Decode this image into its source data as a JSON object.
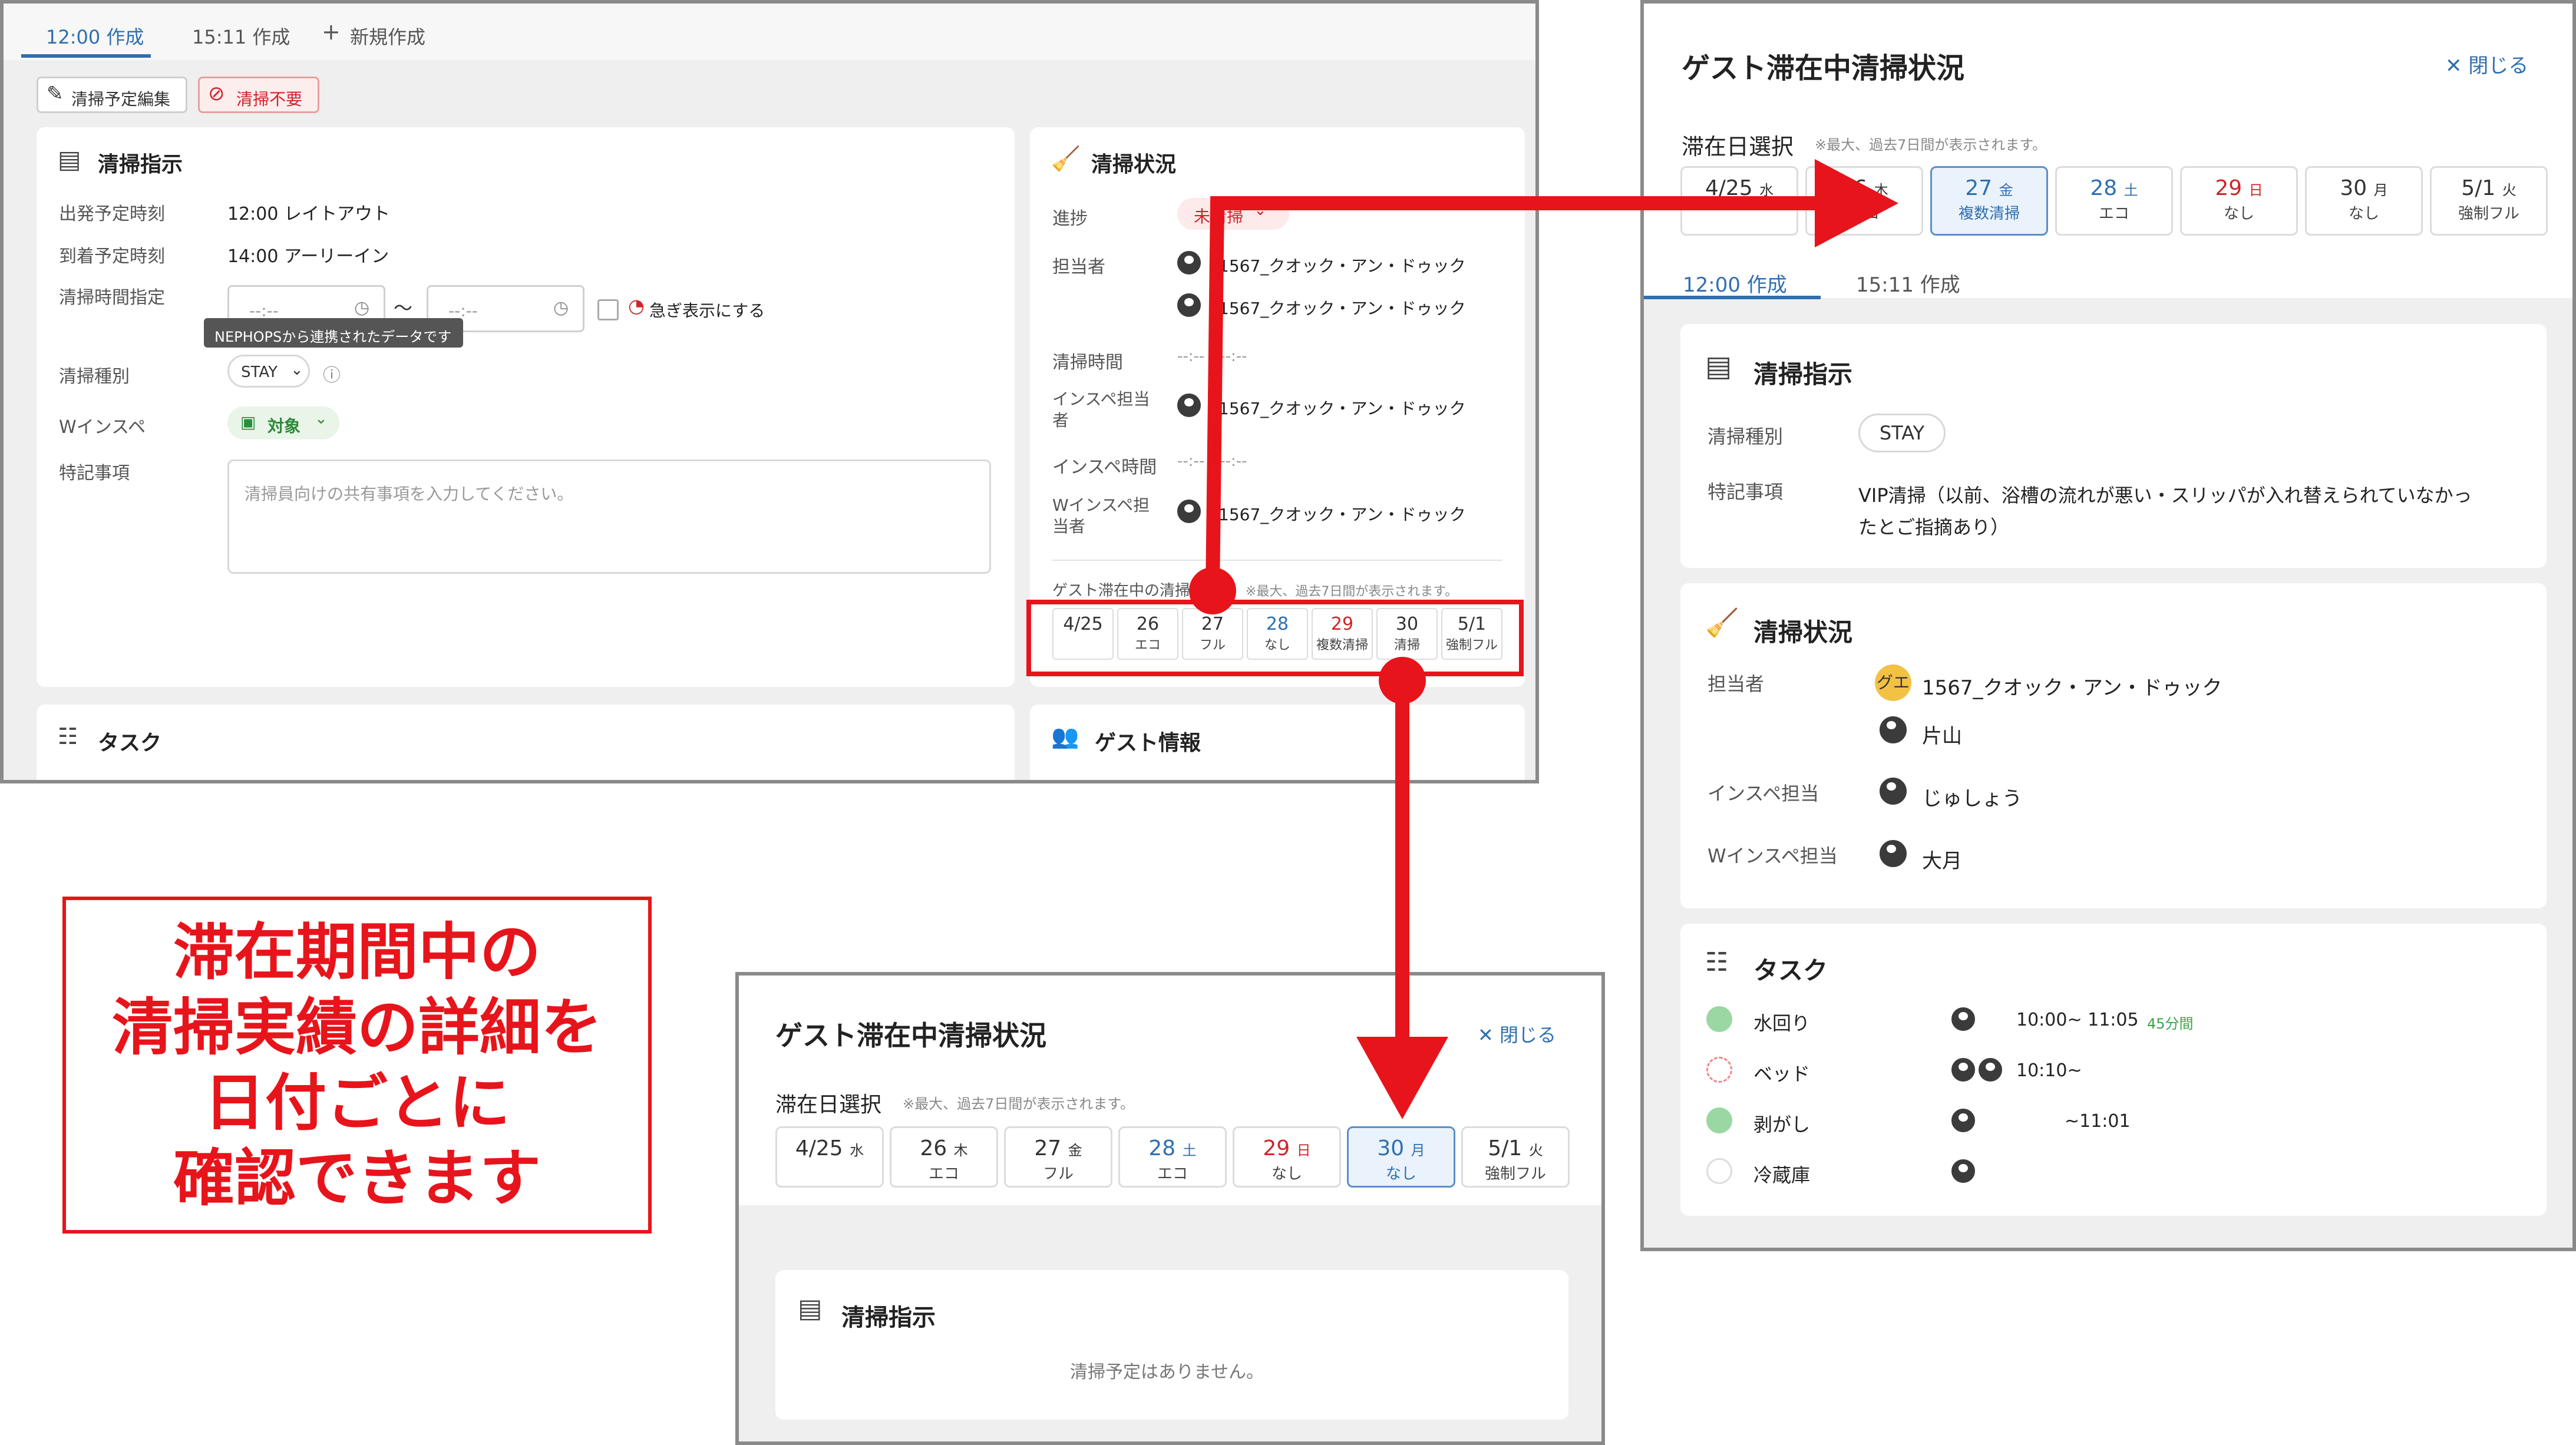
{
  "left_panel": {
    "tabs": [
      "12:00 作成",
      "15:11 作成",
      "新規作成"
    ],
    "toolbar": {
      "edit_label": "清掃予定編集",
      "unneeded_label": "清掃不要"
    },
    "instruction": {
      "title": "清掃指示",
      "rows": [
        {
          "label": "出発予定時刻",
          "value": "12:00 レイトアウト"
        },
        {
          "label": "到着予定時刻",
          "value": "14:00 アーリーイン"
        }
      ],
      "time_label": "清掃時間指定",
      "time_from_placeholder": "--:--",
      "time_to_placeholder": "--:--",
      "time_sep": "〜",
      "urgent_label": "急ぎ表示にする",
      "tooltip": "NEPHOPSから連携されたデータです",
      "type_label": "清掃種別",
      "type_value": "STAY",
      "winspect_label": "Wインスペ",
      "winspect_value": "対象",
      "notes_label": "特記事項",
      "notes_placeholder": "清掃員向けの共有事項を入力してください。"
    },
    "status": {
      "title": "清掃状況",
      "progress_label": "進捗",
      "progress_value": "未清掃",
      "staff_label": "担当者",
      "staff": [
        "1567_クオック・アン・ドゥック",
        "1567_クオック・アン・ドゥック"
      ],
      "clean_time_label": "清掃時間",
      "clean_time_value": "--:-- - --:--",
      "inspector_label": "インスペ担当者",
      "inspector_value": "1567_クオック・アン・ドゥック",
      "inspect_time_label": "インスペ時間",
      "inspect_time_value": "--:-- - --:--",
      "w_inspector_label": "Wインスペ担当者",
      "w_inspector_value": "1567_クオック・アン・ドゥック",
      "guest_label": "ゲスト滞在中の清掃状況",
      "guest_note": "※最大、過去7日間が表示されます。",
      "days": [
        {
          "date": "4/25",
          "status": ""
        },
        {
          "date": "26",
          "status": "エコ"
        },
        {
          "date": "27",
          "status": "フル"
        },
        {
          "date": "28",
          "status": "なし"
        },
        {
          "date": "29",
          "status": "複数清掃"
        },
        {
          "date": "30",
          "status": "清掃"
        },
        {
          "date": "5/1",
          "status": "強制フル"
        }
      ]
    },
    "task_title": "タスク",
    "guest_info_title": "ゲスト情報"
  },
  "right_panel": {
    "title": "ゲスト滞在中清掃状況",
    "close_label": "閉じる",
    "select_label": "滞在日選択",
    "select_note": "※最大、過去7日間が表示されます。",
    "days": [
      {
        "date": "4/25",
        "wd": "水",
        "status": ""
      },
      {
        "date": "26",
        "wd": "木",
        "status": "エコ"
      },
      {
        "date": "27",
        "wd": "金",
        "status": "複数清掃"
      },
      {
        "date": "28",
        "wd": "土",
        "status": "エコ"
      },
      {
        "date": "29",
        "wd": "日",
        "status": "なし"
      },
      {
        "date": "30",
        "wd": "月",
        "status": "なし"
      },
      {
        "date": "5/1",
        "wd": "火",
        "status": "強制フル"
      }
    ],
    "tabs": [
      "12:00 作成",
      "15:11 作成"
    ],
    "instruction": {
      "title": "清掃指示",
      "type_label": "清掃種別",
      "type_value": "STAY",
      "notes_label": "特記事項",
      "notes_line1": "VIP清掃（以前、浴槽の流れが悪い・スリッパが入れ替えられていなかっ",
      "notes_line2": "たとご指摘あり）"
    },
    "status": {
      "title": "清掃状況",
      "staff_label": "担当者",
      "staff1_badge": "グエ",
      "staff1": "1567_クオック・アン・ドゥック",
      "staff2": "片山",
      "inspector_label": "インスペ担当",
      "inspector": "じゅしょう",
      "w_inspector_label": "Wインスペ担当",
      "w_inspector": "大月"
    },
    "tasks": {
      "title": "タスク",
      "items": [
        {
          "name": "水回り",
          "time": "10:00~ 11:05",
          "duration": "45分間",
          "state": "done"
        },
        {
          "name": "ベッド",
          "time": "10:10~",
          "duration": "",
          "state": "progress"
        },
        {
          "name": "剥がし",
          "time": "~11:01",
          "duration": "",
          "state": "done"
        },
        {
          "name": "冷蔵庫",
          "time": "",
          "duration": "",
          "state": "todo"
        }
      ]
    }
  },
  "bottom_panel": {
    "title": "ゲスト滞在中清掃状況",
    "close_label": "閉じる",
    "select_label": "滞在日選択",
    "select_note": "※最大、過去7日間が表示されます。",
    "days": [
      {
        "date": "4/25",
        "wd": "水",
        "status": ""
      },
      {
        "date": "26",
        "wd": "木",
        "status": "エコ"
      },
      {
        "date": "27",
        "wd": "金",
        "status": "フル"
      },
      {
        "date": "28",
        "wd": "土",
        "status": "エコ"
      },
      {
        "date": "29",
        "wd": "日",
        "status": "なし"
      },
      {
        "date": "30",
        "wd": "月",
        "status": "なし"
      },
      {
        "date": "5/1",
        "wd": "火",
        "status": "強制フル"
      }
    ],
    "instruction_title": "清掃指示",
    "empty_text": "清掃予定はありません。"
  },
  "callout": {
    "lines": [
      "滞在期間中の",
      "清掃実績の詳細を",
      "日付ごとに",
      "確認できます"
    ]
  },
  "colors": {
    "accent": "#2f6fb0",
    "annotation_red": "#e8141b",
    "sunday_red": "#d0242b"
  }
}
